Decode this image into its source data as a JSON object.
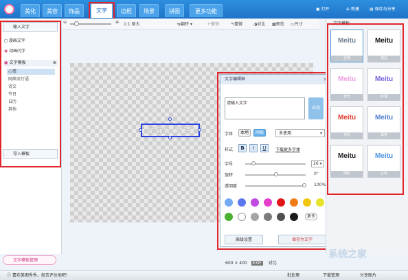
{
  "nav": {
    "tabs": [
      "美化",
      "美容",
      "饰品",
      "文字",
      "边框",
      "场景",
      "拼图",
      "更多功能"
    ],
    "active_index": 3,
    "right": [
      "打开",
      "新建",
      "保存与分享"
    ]
  },
  "toolbar": {
    "zoom_label": "1:1 原大",
    "items": [
      "翻转",
      "撤销",
      "重做",
      "对比",
      "预览",
      "尺寸"
    ]
  },
  "left_panel": {
    "input_text_button": "输入文字",
    "item_1": "漫画文字",
    "item_2": "动画闪字",
    "templates_header": "文字模板",
    "templates": [
      "心情",
      "网络流行语",
      "诗文",
      "节日",
      "日历",
      "其他"
    ],
    "selected_template": 0,
    "import_button": "导入模板"
  },
  "canvas": {
    "text": "请输入文字",
    "size": "600 × 400",
    "size_prefix": "EXIF",
    "compare": "对比"
  },
  "editor": {
    "title": "文字编辑框",
    "close": "×",
    "text_value": "请输入文字",
    "apply_button": "应用",
    "font_label": "字体",
    "font_local": "本地",
    "font_online": "网络",
    "font_select": "未使用",
    "style_label": "样式",
    "bold": "B",
    "italic": "I",
    "underline": "U",
    "download_fonts": "下载更多字体",
    "size_label": "字号",
    "size_value": "26",
    "rotate_label": "旋转",
    "rotate_value": "0°",
    "opacity_label": "透明度",
    "opacity_value": "100%",
    "more_colors": "更多",
    "advanced_button": "高级设置",
    "save_button": "保存为文字"
  },
  "swatches": [
    "#73a9f5",
    "#5a77ee",
    "#c14ae0",
    "#e43dc8",
    "#e21616",
    "#f07a16",
    "#f2c510",
    "#e6e32b",
    "#4ab02f",
    "#ffffff",
    "#a5a5a5",
    "#7a7a7a",
    "#4f4f4f",
    "#1b1b1b"
  ],
  "right_panel": {
    "title": "文字模板",
    "templates": [
      {
        "word": "Meitu",
        "caption": "正常",
        "color": "#6f7f91",
        "selected": true
      },
      {
        "word": "Meitu",
        "caption": "描边",
        "color": "#111111"
      },
      {
        "word": "Meitu",
        "caption": "荧光",
        "color": "#ee9ee3"
      },
      {
        "word": "Meitu",
        "caption": "纹理",
        "color": "#7761dd"
      },
      {
        "word": "Meitu",
        "caption": "多彩",
        "color": "#e03b2f"
      },
      {
        "word": "Meitu",
        "caption": "渐变",
        "color": "#4f7fd1"
      },
      {
        "word": "Meitu",
        "caption": "阴影",
        "color": "#222222"
      },
      {
        "word": "Meitu",
        "caption": "立体",
        "color": "#4b93dd"
      }
    ]
  },
  "bottom_tag": "文字模板管理",
  "status": {
    "left": "喜欢美图秀秀，就去评价他吧！",
    "right_1": "批处理",
    "right_2": "下载管理",
    "right_3": "分享图片"
  },
  "watermark": "系统之家"
}
